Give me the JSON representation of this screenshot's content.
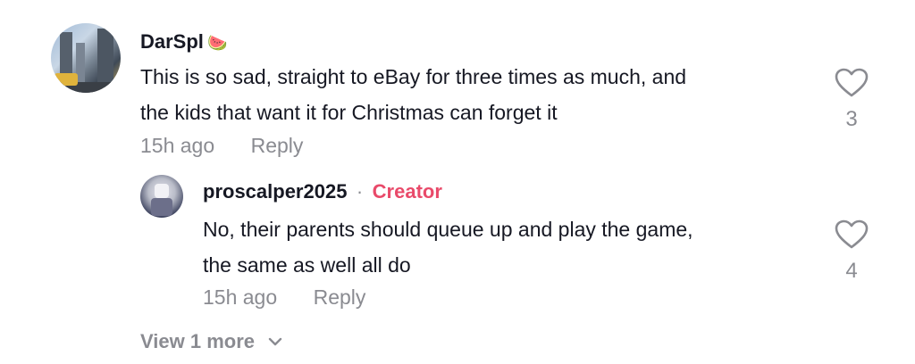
{
  "comment": {
    "username": "DarSpl",
    "emoji": "🍉",
    "text_line1": "This is so sad, straight to eBay for three times as much, and",
    "text_line2": "the kids that want it for Christmas can forget it",
    "time": "15h ago",
    "reply_label": "Reply",
    "likes": "3"
  },
  "reply": {
    "username": "proscalper2025",
    "separator": "·",
    "badge": "Creator",
    "text_line1": "No, their parents should queue up and play the game,",
    "text_line2": "the same as well all do",
    "time": "15h ago",
    "reply_label": "Reply",
    "likes": "4"
  },
  "view_more": {
    "label": "View 1 more"
  },
  "colors": {
    "creator_accent": "#e94a6a",
    "muted": "#8a8b91",
    "text": "#161823"
  },
  "icons": {
    "like": "heart-outline-icon",
    "expand": "chevron-down-icon"
  }
}
